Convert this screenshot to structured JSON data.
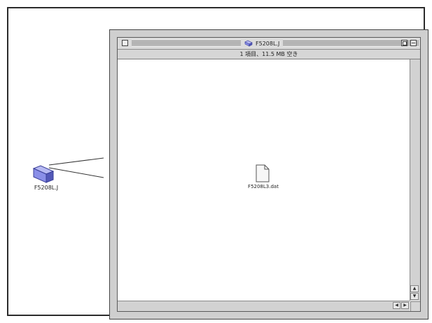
{
  "desktop": {
    "folder_label": "F5208L.J",
    "folder_icon": "folder-icon"
  },
  "window": {
    "title": "F5208L.J",
    "title_icon": "folder-icon",
    "info_text": "1 項目、11.5 MB 空き",
    "files": [
      {
        "name": "F5208L3.dat",
        "icon": "document-icon"
      }
    ]
  },
  "colors": {
    "folder_fill": "#8a8fe8",
    "folder_shade": "#5358b8",
    "frame_border": "#2b2b2b"
  }
}
